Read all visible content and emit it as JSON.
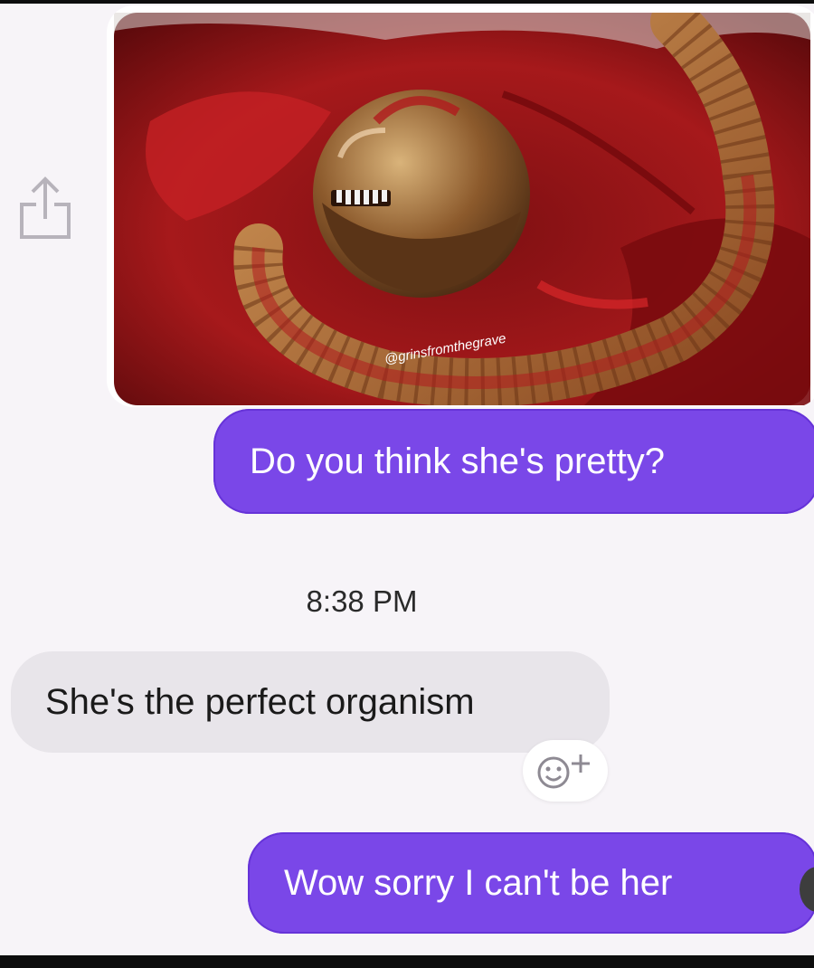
{
  "thread": {
    "image": {
      "subject": "alien-chestburster-photo",
      "watermark": "@grinsfromthegrave"
    },
    "messages": [
      {
        "direction": "sent",
        "text": "Do you think she's pretty?"
      },
      {
        "direction": "received",
        "text": "She's the perfect organism"
      },
      {
        "direction": "sent",
        "text": "Wow sorry I can't be her"
      }
    ],
    "timestamp": "8:38 PM"
  },
  "icons": {
    "share": "share-icon",
    "reaction": "add-reaction-icon"
  },
  "colors": {
    "sent_bubble": "#7a47e8",
    "received_bubble": "#e8e5ea",
    "background": "#f7f4f8"
  }
}
